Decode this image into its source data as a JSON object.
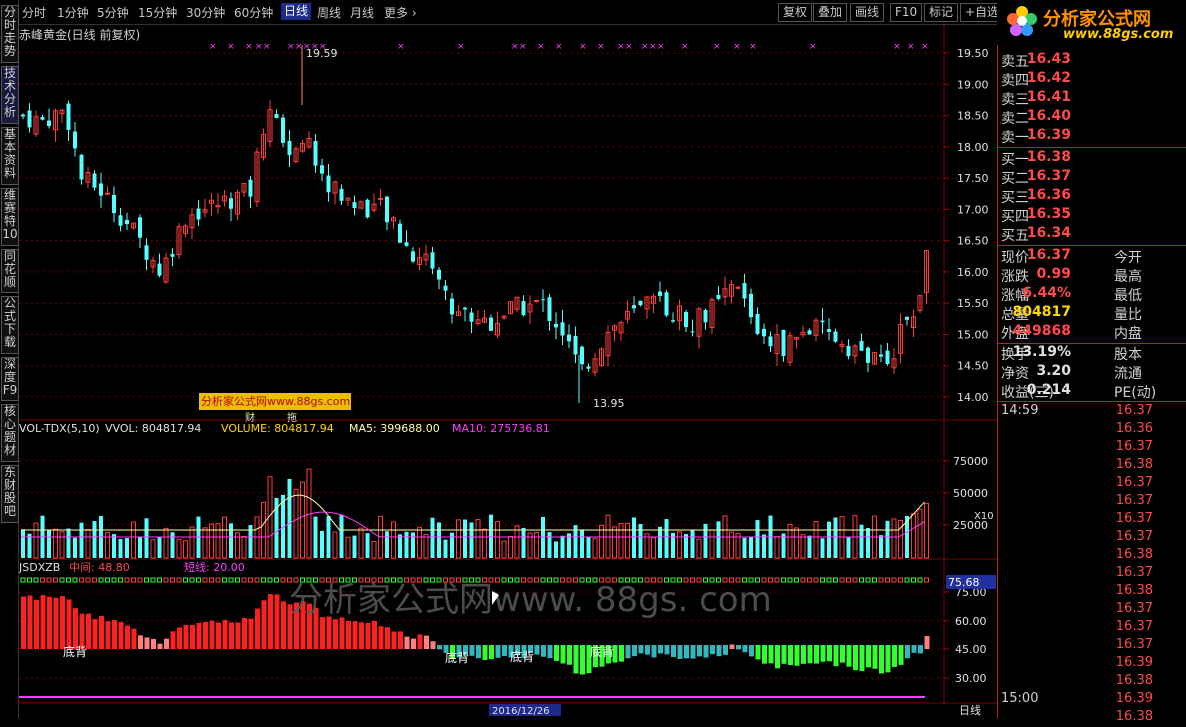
{
  "colors": {
    "up": "#ff3c3c",
    "down": "#54ffff",
    "ma5": "#ffffa0",
    "ma10": "#ff3cff",
    "grid": "#7a0000",
    "accent_yellow": "#ffd800"
  },
  "period_tabs": [
    "分时",
    "1分钟",
    "5分钟",
    "15分钟",
    "30分钟",
    "60分钟",
    "日线",
    "周线",
    "月线",
    "更多 ›"
  ],
  "active_period": "日线",
  "right_buttons": [
    "复权",
    "叠加",
    "画线",
    "F10",
    "标记",
    "+自选"
  ],
  "side_tabs": [
    "分时走势",
    "技术分析",
    "基本资料",
    "维赛特10",
    "同花顺",
    "公式下载",
    "深度F9",
    "核心题材",
    "东财股吧"
  ],
  "logo": {
    "text": "分析家公式网",
    "url": "www.88gs.com"
  },
  "chart": {
    "title": "赤峰黄金(日线 前复权)",
    "high_label": "19.59",
    "low_label": "13.95",
    "price_axis": [
      "19.50",
      "19.00",
      "18.50",
      "18.00",
      "17.50",
      "17.00",
      "16.50",
      "16.00",
      "15.50",
      "15.00",
      "14.50",
      "14.00"
    ],
    "watermark_small": "分析家公式网www.88gs.com",
    "marker_cai": "财",
    "marker_tuo": "拖"
  },
  "vol": {
    "name": "VOL-TDX(5,10)",
    "vvol": "VVOL: 804817.94",
    "volume": "VOLUME: 804817.94",
    "ma5": "MA5: 399688.00",
    "ma10": "MA10: 275736.81",
    "axis": [
      "75000",
      "50000",
      "25000"
    ],
    "unit": "X10"
  },
  "ind": {
    "name": "JSDXZB",
    "mid": "中间: 48.80",
    "short": "短线: 20.00",
    "current": "75.68",
    "axis": [
      "75.00",
      "60.00",
      "45.00",
      "30.00"
    ],
    "divergences": [
      "底背",
      "底背",
      "底背",
      "底背"
    ],
    "watermark_big": "分析家公式网www. 88gs. com"
  },
  "bottom": {
    "date_box": "2016/12/26",
    "right_label": "日线"
  },
  "quote": {
    "asks": [
      {
        "label": "卖五",
        "price": "16.43"
      },
      {
        "label": "卖四",
        "price": "16.42"
      },
      {
        "label": "卖三",
        "price": "16.41"
      },
      {
        "label": "卖二",
        "price": "16.40"
      },
      {
        "label": "卖一",
        "price": "16.39"
      }
    ],
    "bids": [
      {
        "label": "买一",
        "price": "16.38"
      },
      {
        "label": "买二",
        "price": "16.37"
      },
      {
        "label": "买三",
        "price": "16.36"
      },
      {
        "label": "买四",
        "price": "16.35"
      },
      {
        "label": "买五",
        "price": "16.34"
      }
    ],
    "stats": [
      {
        "label": "现价",
        "value": "16.37",
        "label2": "今开",
        "color": "#ff4a4a"
      },
      {
        "label": "涨跌",
        "value": "0.99",
        "label2": "最高",
        "color": "#ff4a4a"
      },
      {
        "label": "涨幅",
        "value": "6.44%",
        "label2": "最低",
        "color": "#ff4a4a"
      },
      {
        "label": "总量",
        "value": "804817",
        "label2": "量比",
        "color": "#ffd800"
      },
      {
        "label": "外盘",
        "value": "449868",
        "label2": "内盘",
        "color": "#ff4a4a"
      }
    ],
    "stats2": [
      {
        "label": "换手",
        "value": "13.19%",
        "label2": "股本"
      },
      {
        "label": "净资",
        "value": "3.20",
        "label2": "流通"
      },
      {
        "label": "收益(三)",
        "value": "0.214",
        "label2": "PE(动)"
      }
    ],
    "ticks": [
      {
        "time": "14:59",
        "price": "16.37"
      },
      {
        "time": "",
        "price": "16.36"
      },
      {
        "time": "",
        "price": "16.37"
      },
      {
        "time": "",
        "price": "16.38"
      },
      {
        "time": "",
        "price": "16.37"
      },
      {
        "time": "",
        "price": "16.37"
      },
      {
        "time": "",
        "price": "16.37"
      },
      {
        "time": "",
        "price": "16.37"
      },
      {
        "time": "",
        "price": "16.38"
      },
      {
        "time": "",
        "price": "16.37"
      },
      {
        "time": "",
        "price": "16.38"
      },
      {
        "time": "",
        "price": "16.37"
      },
      {
        "time": "",
        "price": "16.37"
      },
      {
        "time": "",
        "price": "16.37"
      },
      {
        "time": "",
        "price": "16.39"
      },
      {
        "time": "",
        "price": "16.38"
      },
      {
        "time": "15:00",
        "price": "16.39"
      },
      {
        "time": "",
        "price": "16.38"
      }
    ]
  }
}
